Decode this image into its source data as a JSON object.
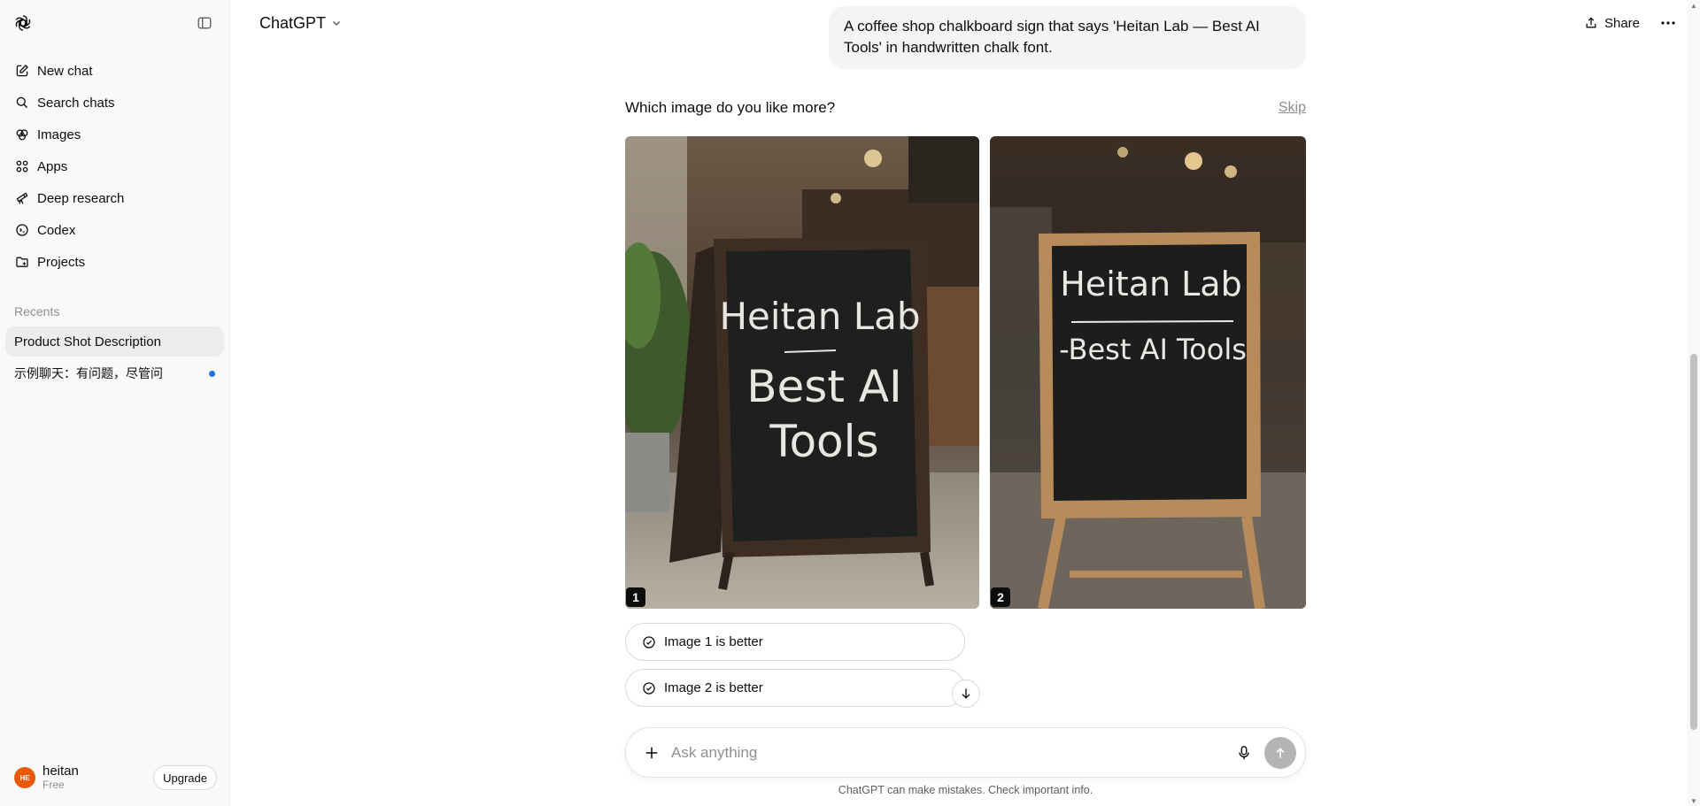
{
  "app": {
    "title": "ChatGPT"
  },
  "sidebar": {
    "nav": [
      {
        "label": "New chat",
        "icon": "new-chat-icon"
      },
      {
        "label": "Search chats",
        "icon": "search-icon"
      },
      {
        "label": "Images",
        "icon": "images-icon"
      },
      {
        "label": "Apps",
        "icon": "apps-icon"
      },
      {
        "label": "Deep research",
        "icon": "telescope-icon"
      },
      {
        "label": "Codex",
        "icon": "codex-icon"
      },
      {
        "label": "Projects",
        "icon": "folder-icon"
      }
    ],
    "recents_label": "Recents",
    "recents": [
      {
        "label": "Product Shot Description"
      },
      {
        "label": "示例聊天：有问题，尽管问"
      }
    ],
    "user": {
      "name": "heitan",
      "plan": "Free",
      "initials": "HE"
    },
    "upgrade_label": "Upgrade"
  },
  "header": {
    "model": "ChatGPT",
    "share_label": "Share"
  },
  "conversation": {
    "user_message": "A coffee shop chalkboard sign that says 'Heitan Lab — Best AI Tools' in handwritten chalk font."
  },
  "comparison": {
    "question": "Which image do you like more?",
    "skip_label": "Skip",
    "images": [
      {
        "badge": "1",
        "sign_lines": [
          "Heitan Lab",
          "Best AI",
          "Tools"
        ]
      },
      {
        "badge": "2",
        "sign_lines": [
          "Heitan Lab",
          "-Best AI Tools"
        ]
      }
    ],
    "choices": [
      "Image 1 is better",
      "Image 2 is better"
    ]
  },
  "composer": {
    "placeholder": "Ask anything"
  },
  "disclaimer": "ChatGPT can make mistakes. Check important info.",
  "colors": {
    "avatar": "#e8590c",
    "unread_dot": "#1a73e8",
    "active_recent": "#ececec"
  }
}
